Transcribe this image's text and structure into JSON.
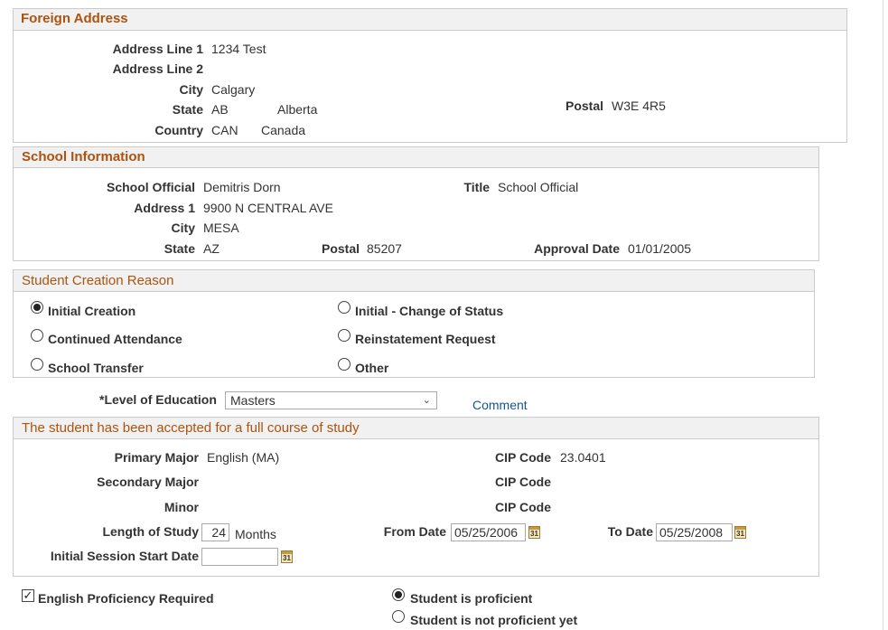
{
  "foreign_address": {
    "title": "Foreign Address",
    "address_line1_label": "Address Line 1",
    "address_line1": "1234 Test",
    "address_line2_label": "Address Line 2",
    "address_line2": "",
    "city_label": "City",
    "city": "Calgary",
    "state_label": "State",
    "state_code": "AB",
    "state_name": "Alberta",
    "postal_label": "Postal",
    "postal": "W3E 4R5",
    "country_label": "Country",
    "country_code": "CAN",
    "country_name": "Canada"
  },
  "school_information": {
    "title": "School Information",
    "official_label": "School Official",
    "official": "Demitris Dorn",
    "title_label": "Title",
    "official_title": "School Official",
    "address1_label": "Address 1",
    "address1": "9900 N CENTRAL AVE",
    "city_label": "City",
    "city": "MESA",
    "state_label": "State",
    "state": "AZ",
    "postal_label": "Postal",
    "postal": "85207",
    "approval_date_label": "Approval Date",
    "approval_date": "01/01/2005"
  },
  "creation_reason": {
    "title": "Student Creation Reason",
    "options": [
      {
        "label": "Initial Creation",
        "selected": true
      },
      {
        "label": "Initial - Change of Status",
        "selected": false
      },
      {
        "label": "Continued Attendance",
        "selected": false
      },
      {
        "label": "Reinstatement Request",
        "selected": false
      },
      {
        "label": "School Transfer",
        "selected": false
      },
      {
        "label": "Other",
        "selected": false
      }
    ]
  },
  "level_of_education": {
    "label": "*Level of Education",
    "value": "Masters",
    "comment_link": "Comment"
  },
  "course_of_study": {
    "title": "The student has been accepted for a full course of study",
    "primary_major_label": "Primary Major",
    "primary_major": "English (MA)",
    "cip_code_label": "CIP Code",
    "primary_cip": "23.0401",
    "secondary_major_label": "Secondary Major",
    "secondary_major": "",
    "secondary_cip": "",
    "minor_label": "Minor",
    "minor": "",
    "minor_cip": "",
    "length_label": "Length of Study",
    "length_value": "24",
    "length_unit": "Months",
    "from_date_label": "From Date",
    "from_date": "05/25/2006",
    "to_date_label": "To Date",
    "to_date": "05/25/2008",
    "session_start_label": "Initial Session Start Date",
    "session_start": "",
    "calendar_glyph": "31"
  },
  "english_proficiency": {
    "required_label": "English Proficiency Required",
    "required_checked": true,
    "options": [
      {
        "label": "Student is proficient",
        "selected": true
      },
      {
        "label": "Student is not proficient yet",
        "selected": false
      }
    ]
  }
}
